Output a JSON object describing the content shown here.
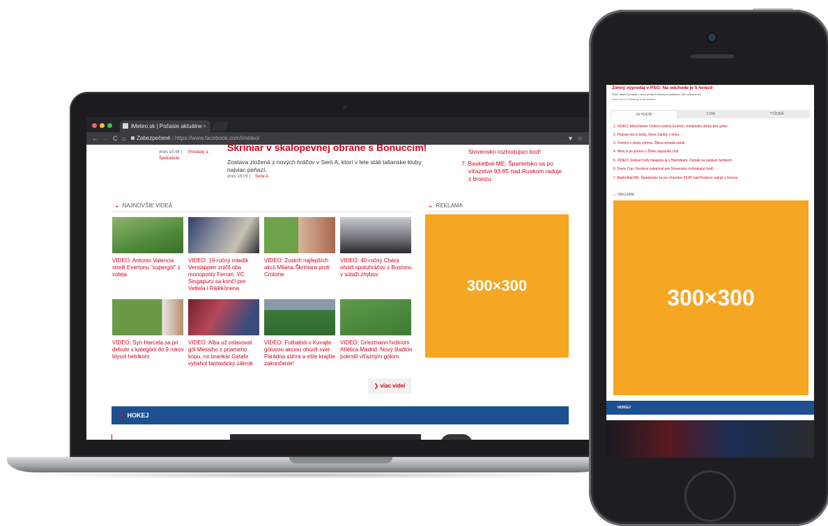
{
  "browser": {
    "tab_title": "iMeteo.sk | Počasie aktuálne",
    "tab_close": "×",
    "secure_label": "Zabezpečené",
    "url": "https://www.facebook.com/imeteo/",
    "nav_back": "←",
    "nav_forward": "→",
    "nav_reload": "C",
    "nav_home": "⌂",
    "ext_icon": "▼",
    "star_icon": "☆"
  },
  "laptop_page": {
    "left_snippet_time": "dnes 15:44 |",
    "left_snippet_tag1": "Prestupy a",
    "left_snippet_tag2": "Špekulácie",
    "headline": "Škriniar v skalopevnej obrane s Bonuccim!",
    "article_text1": "Zostava zložená z nových hráčov v Serii A, ktorí v lete stáli talianske kluby",
    "article_text2": "najviac peňazí.",
    "article_meta_time": "dnes 16:09 |",
    "article_meta_tag": "Serie A",
    "right_item6_line1": "Slovensko rozhodujúci bod!",
    "right_item7_line1": "7. Basketbal-ME: Španielsko sa po",
    "right_item7_line2": "víťazstve 93:85 nad Ruskom raduje",
    "right_item7_line3": "z bronzu",
    "videos_heading": "NAJNOVŠIE VIDEÁ",
    "ad_heading": "REKLAMA",
    "ad_text": "300×300",
    "more_videos": "viac videí",
    "more_icon": "❯",
    "hokej_label": "HOKEJ",
    "chevron": "❯"
  },
  "videos": [
    {
      "caption": "VIDEO: Antonio Valencia strelil Evertonu \"supergól\" z voleja"
    },
    {
      "caption": "VIDEO: 19-ročný mladík Verstappen zničil oba monoposty Ferrari. VC Singapuru sa končí pre Vettela i Räikkönena"
    },
    {
      "caption": "VIDEO: Zostrih najlepších akcií Milana Škriniara proti Crotone"
    },
    {
      "caption": "VIDEO: 40-ročný Chára ohúril spoluhráčov z Bostonu v sútaži zhybov"
    },
    {
      "caption": "VIDEO: Syn Harcela sa pri debute v kategórii do 9 rokov blysol hetrikom"
    },
    {
      "caption": "VIDEO: Alba už oslavoval gól Messiho z priameho kopu, no brankár Getafe vytiahol fantastický zákrok"
    },
    {
      "caption": "VIDEO: Futbalisti v Kuvajte gólovou akciou ohúrili svet. Parádna súhra a ešte krajšie zakončenie!"
    },
    {
      "caption": "VIDEO: Griezmann hrdinom Atlética Madrid. Nový štadión pokrstil víťazným gólom"
    }
  ],
  "phone_page": {
    "headline": "Zimný výpredaj v PSG: Na odchode je 5 hviezd",
    "subtext": "Paríž Saint-Germain v zime predá 5 hviezd za približne 150 miliónov eur.",
    "meta": "dnes 15:44 | Prestupy a špekulácie",
    "tabs": [
      "24 HODÍN",
      "3 DNI",
      "TÝŽDEŇ"
    ],
    "list": [
      "1. VIDEO: Manchester United rozdrvil Everton, londýnske derby bez gólov",
      "2. Poprad má tri body, Nové Zámky v kríze",
      "3. Trenčín v útoku výhrou, Žilina nemala nárok",
      "4. Nitra si po prehre v Žiline napravila chuť",
      "5. VIDEO: Gólové hody Neapola aj s Hamšíkom, Dybala sa zaskvel hetrikom",
      "6. Davis Cup: Gombos vybojoval pre Slovensko rozhodujúci bod!",
      "7. Basketbal-ME: Španielsko sa po víťazstve 93:85 nad Ruskom raduje z bronzu"
    ],
    "ad_heading": "REKLAMA",
    "ad_text": "300×300",
    "hokej_label": "HOKEJ"
  },
  "colors": {
    "accent_red": "#d0021b",
    "ad_orange": "#f5a623",
    "hokej_blue": "#1d4f91"
  }
}
